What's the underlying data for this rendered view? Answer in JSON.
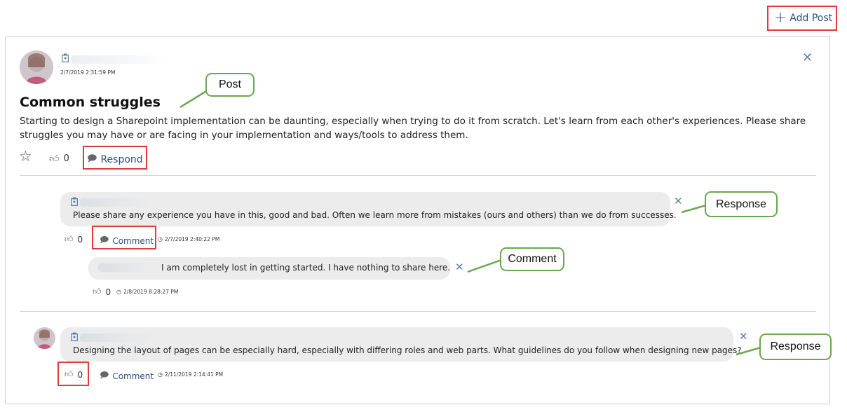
{
  "toolbar": {
    "add_post_label": "Add Post"
  },
  "post": {
    "timestamp": "2/7/2019 2:31:59 PM",
    "title": "Common struggles",
    "body_line1": "Starting to design a Sharepoint implementation can be daunting, especially when trying to do it from scratch. Let's learn from each other's experiences. Please share",
    "body_line2": "struggles you may have or are facing in your implementation and ways/tools to address them.",
    "like_count": "0",
    "respond_label": "Respond"
  },
  "responses": [
    {
      "text": "Please share any experience you have in this, good and bad. Often we learn more from mistakes (ours and others) than we do from successes.",
      "like_count": "0",
      "comment_label": "Comment",
      "timestamp": "2/7/2019 2:40:22 PM",
      "comments": [
        {
          "text": "I am completely lost in getting started. I have nothing to share here.",
          "like_count": "0",
          "timestamp": "2/8/2019 8:28:27 PM"
        }
      ]
    },
    {
      "text": "Designing the layout of pages can be especially hard, especially with differing roles and web parts. What guidelines do you follow when designing new pages?",
      "like_count": "0",
      "comment_label": "Comment",
      "timestamp": "2/11/2019 2:14:41 PM"
    }
  ],
  "callouts": {
    "post": "Post",
    "response1": "Response",
    "comment": "Comment",
    "response2": "Response"
  },
  "colors": {
    "annotation_red": "#e0393e",
    "callout_green": "#6aa84f",
    "link_blue": "#2b4f7e"
  }
}
